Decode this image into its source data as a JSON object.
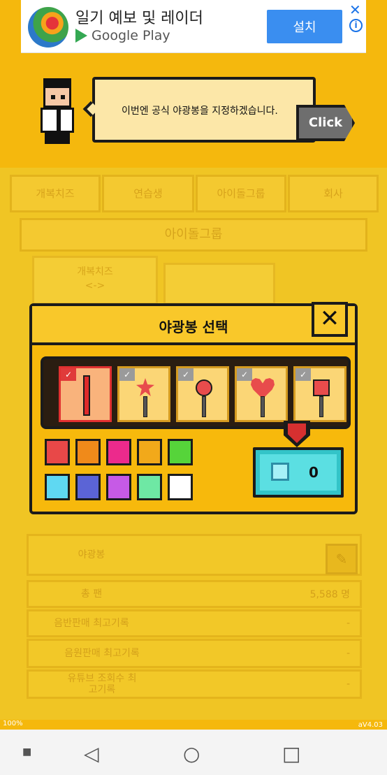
{
  "ad": {
    "title": "일기 예보 및 레이더",
    "subtitle": "Google Play",
    "install_label": "설치",
    "close_glyph": "✕",
    "info_glyph": "i"
  },
  "dialog": {
    "message": "이번엔 공식 야광봉을 지정하겠습니다.",
    "click_label": "Click"
  },
  "background": {
    "tabs": [
      "개복치즈",
      "연습생",
      "아이돌그룹",
      "회사"
    ],
    "section_title": "아이돌그룹",
    "card_name": "개복치즈",
    "card_sub": "<->",
    "lightstick_label": "야광봉",
    "stats": [
      {
        "label": "총 팬",
        "value": "5,588 명"
      },
      {
        "label": "음반판매 최고기록",
        "value": "-"
      },
      {
        "label": "음원판매 최고기록",
        "value": "-"
      },
      {
        "label": "유튜브 조회수 최고기록",
        "value": "-"
      }
    ]
  },
  "modal": {
    "title": "야광봉 선택",
    "close_glyph": "✕",
    "sticks": [
      {
        "name": "기본",
        "selected": true,
        "head_color": "#e02a2a"
      },
      {
        "name": "별",
        "selected": false,
        "head_color": "#e84c4c"
      },
      {
        "name": "원",
        "selected": false,
        "head_color": "#e84c4c"
      },
      {
        "name": "하트",
        "selected": false,
        "head_color": "#e84c4c"
      },
      {
        "name": "사각",
        "selected": false,
        "head_color": "#e84c4c"
      }
    ],
    "colors": [
      "#e84848",
      "#f08a1a",
      "#ec2a8c",
      "#f2a91a",
      "#56d43a",
      "#5fd8f2",
      "#5b64d6",
      "#c65ae6",
      "#6ee8a4",
      "#ffffff"
    ],
    "price": "0"
  },
  "footer": {
    "zoom": "100%",
    "version": "aV4.03"
  },
  "navbar": {
    "square_small": "■",
    "back": "◁",
    "home": "○",
    "recent": "□"
  }
}
